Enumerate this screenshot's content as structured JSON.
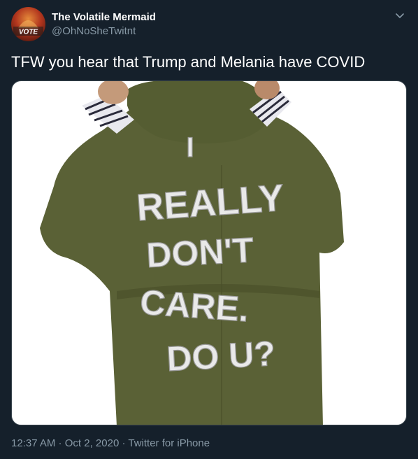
{
  "user": {
    "display_name": "The Volatile Mermaid",
    "handle": "@OhNoSheTwitnt",
    "avatar_badge": "VOTE"
  },
  "tweet": {
    "text": "TFW you hear that Trump and Melania have COVID"
  },
  "media": {
    "jacket_text": [
      "I",
      "REALLY",
      "DON'T",
      "CARE.",
      "DO U?"
    ]
  },
  "meta": {
    "time": "12:37 AM",
    "sep1": " · ",
    "date": "Oct 2, 2020",
    "sep2": " · ",
    "source": "Twitter for iPhone"
  },
  "colors": {
    "background": "#15202b",
    "secondary_text": "#8899a6",
    "jacket": "#5a6136"
  },
  "icons": [
    "chevron-down-icon"
  ]
}
